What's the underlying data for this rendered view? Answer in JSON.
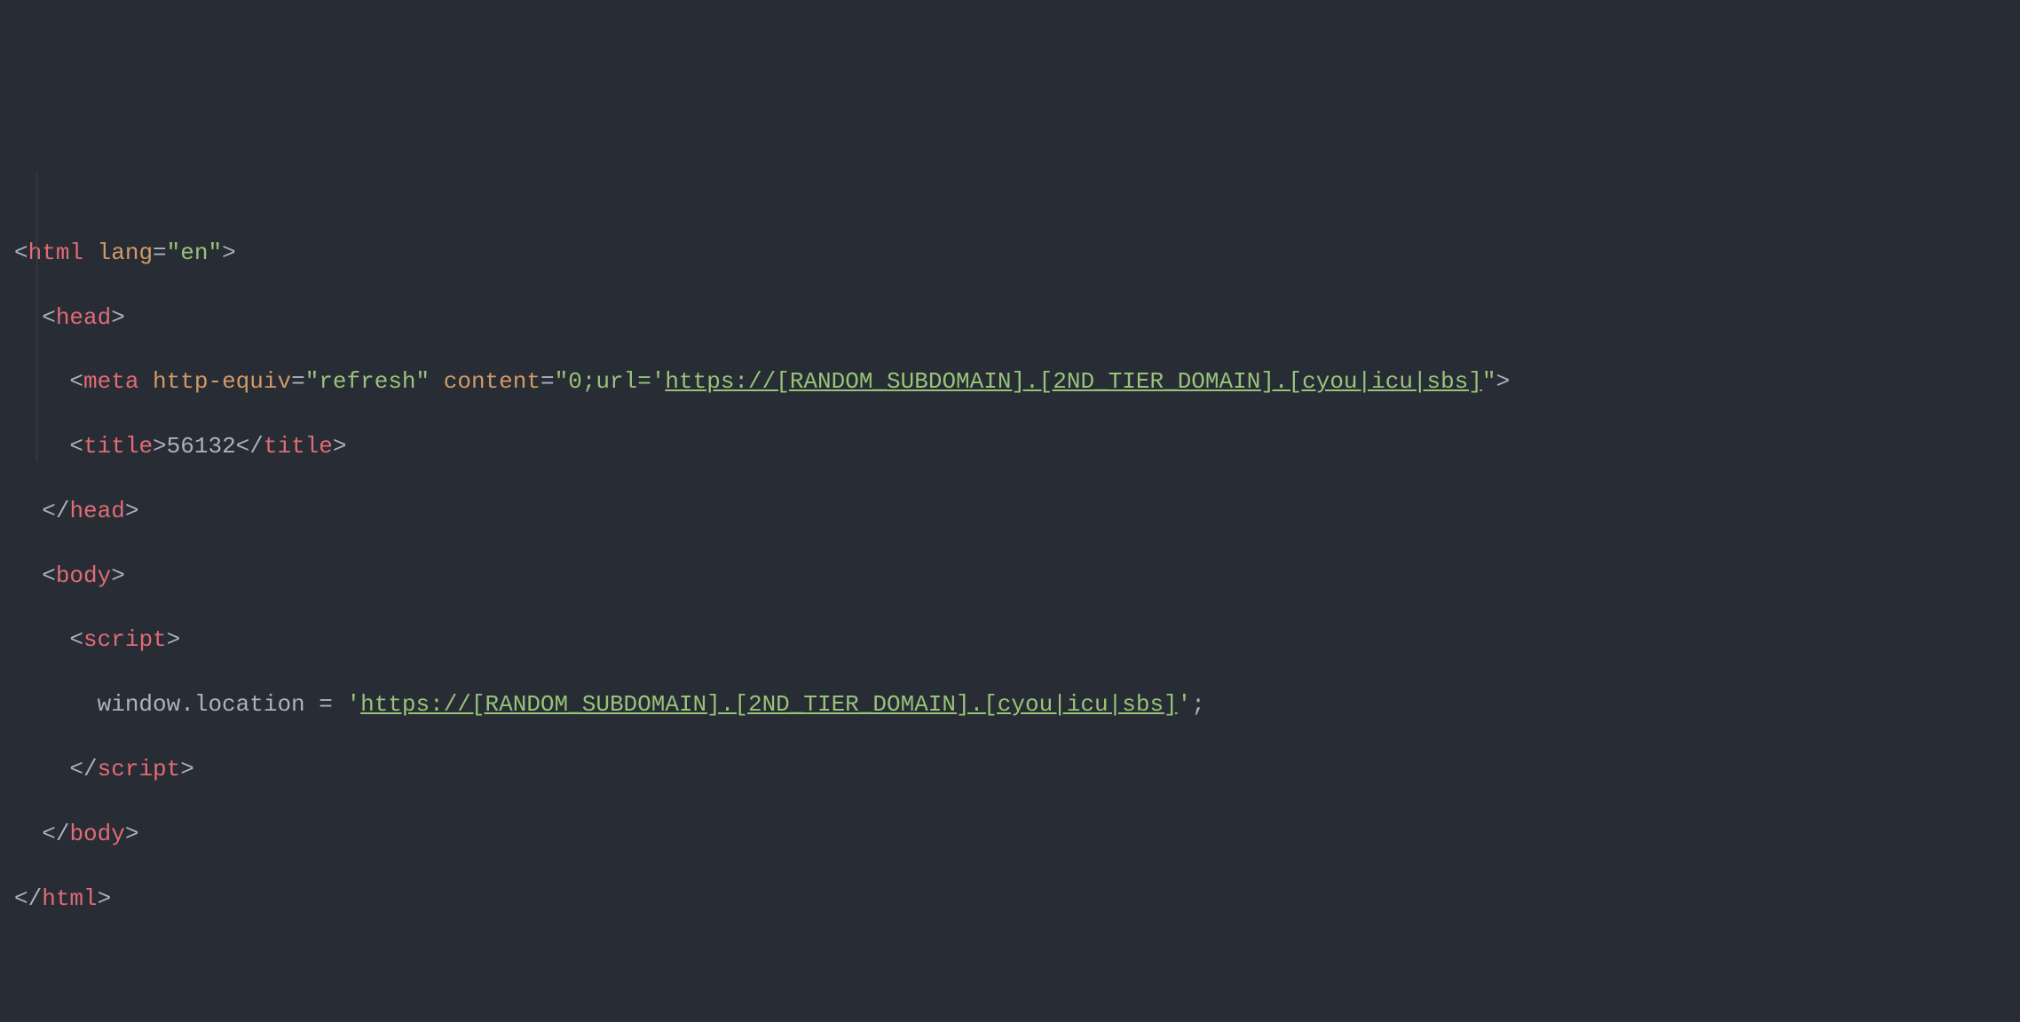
{
  "code": {
    "line1": {
      "bracket_open": "<",
      "tag": "html",
      "attr": " lang",
      "eq": "=",
      "quote1": "\"",
      "value": "en",
      "quote2": "\"",
      "bracket_close": ">"
    },
    "line2": {
      "indent": "  ",
      "bracket_open": "<",
      "tag": "head",
      "bracket_close": ">"
    },
    "line3": {
      "indent": "    ",
      "bracket_open": "<",
      "tag": "meta",
      "attr1": " http-equiv",
      "eq1": "=",
      "quote1a": "\"",
      "value1": "refresh",
      "quote1b": "\"",
      "attr2": " content",
      "eq2": "=",
      "quote2a": "\"",
      "value2_prefix": "0;url='",
      "value2_url": "https://[RANDOM_SUBDOMAIN].[2ND_TIER_DOMAIN].[cyou|icu|sbs]",
      "quote2b": "\"",
      "bracket_close": ">"
    },
    "line4": {
      "indent": "    ",
      "bracket_open": "<",
      "tag_open": "title",
      "bracket_mid1": ">",
      "text": "56132",
      "bracket_mid2": "</",
      "tag_close": "title",
      "bracket_close": ">"
    },
    "line5": {
      "indent": "  ",
      "bracket_open": "</",
      "tag": "head",
      "bracket_close": ">"
    },
    "line6": {
      "indent": "  ",
      "bracket_open": "<",
      "tag": "body",
      "bracket_close": ">"
    },
    "line7": {
      "indent": "    ",
      "bracket_open": "<",
      "tag": "script",
      "bracket_close": ">"
    },
    "line8": {
      "indent": "      ",
      "code_prefix": "window.location = ",
      "quote1": "'",
      "url": "https://[RANDOM_SUBDOMAIN].[2ND_TIER_DOMAIN].[cyou|icu|sbs]",
      "quote2": "'",
      "semicolon": ";"
    },
    "line9": {
      "indent": "    ",
      "bracket_open": "</",
      "tag": "script",
      "bracket_close": ">"
    },
    "line10": {
      "indent": "  ",
      "bracket_open": "</",
      "tag": "body",
      "bracket_close": ">"
    },
    "line11": {
      "bracket_open": "</",
      "tag": "html",
      "bracket_close": ">"
    }
  }
}
